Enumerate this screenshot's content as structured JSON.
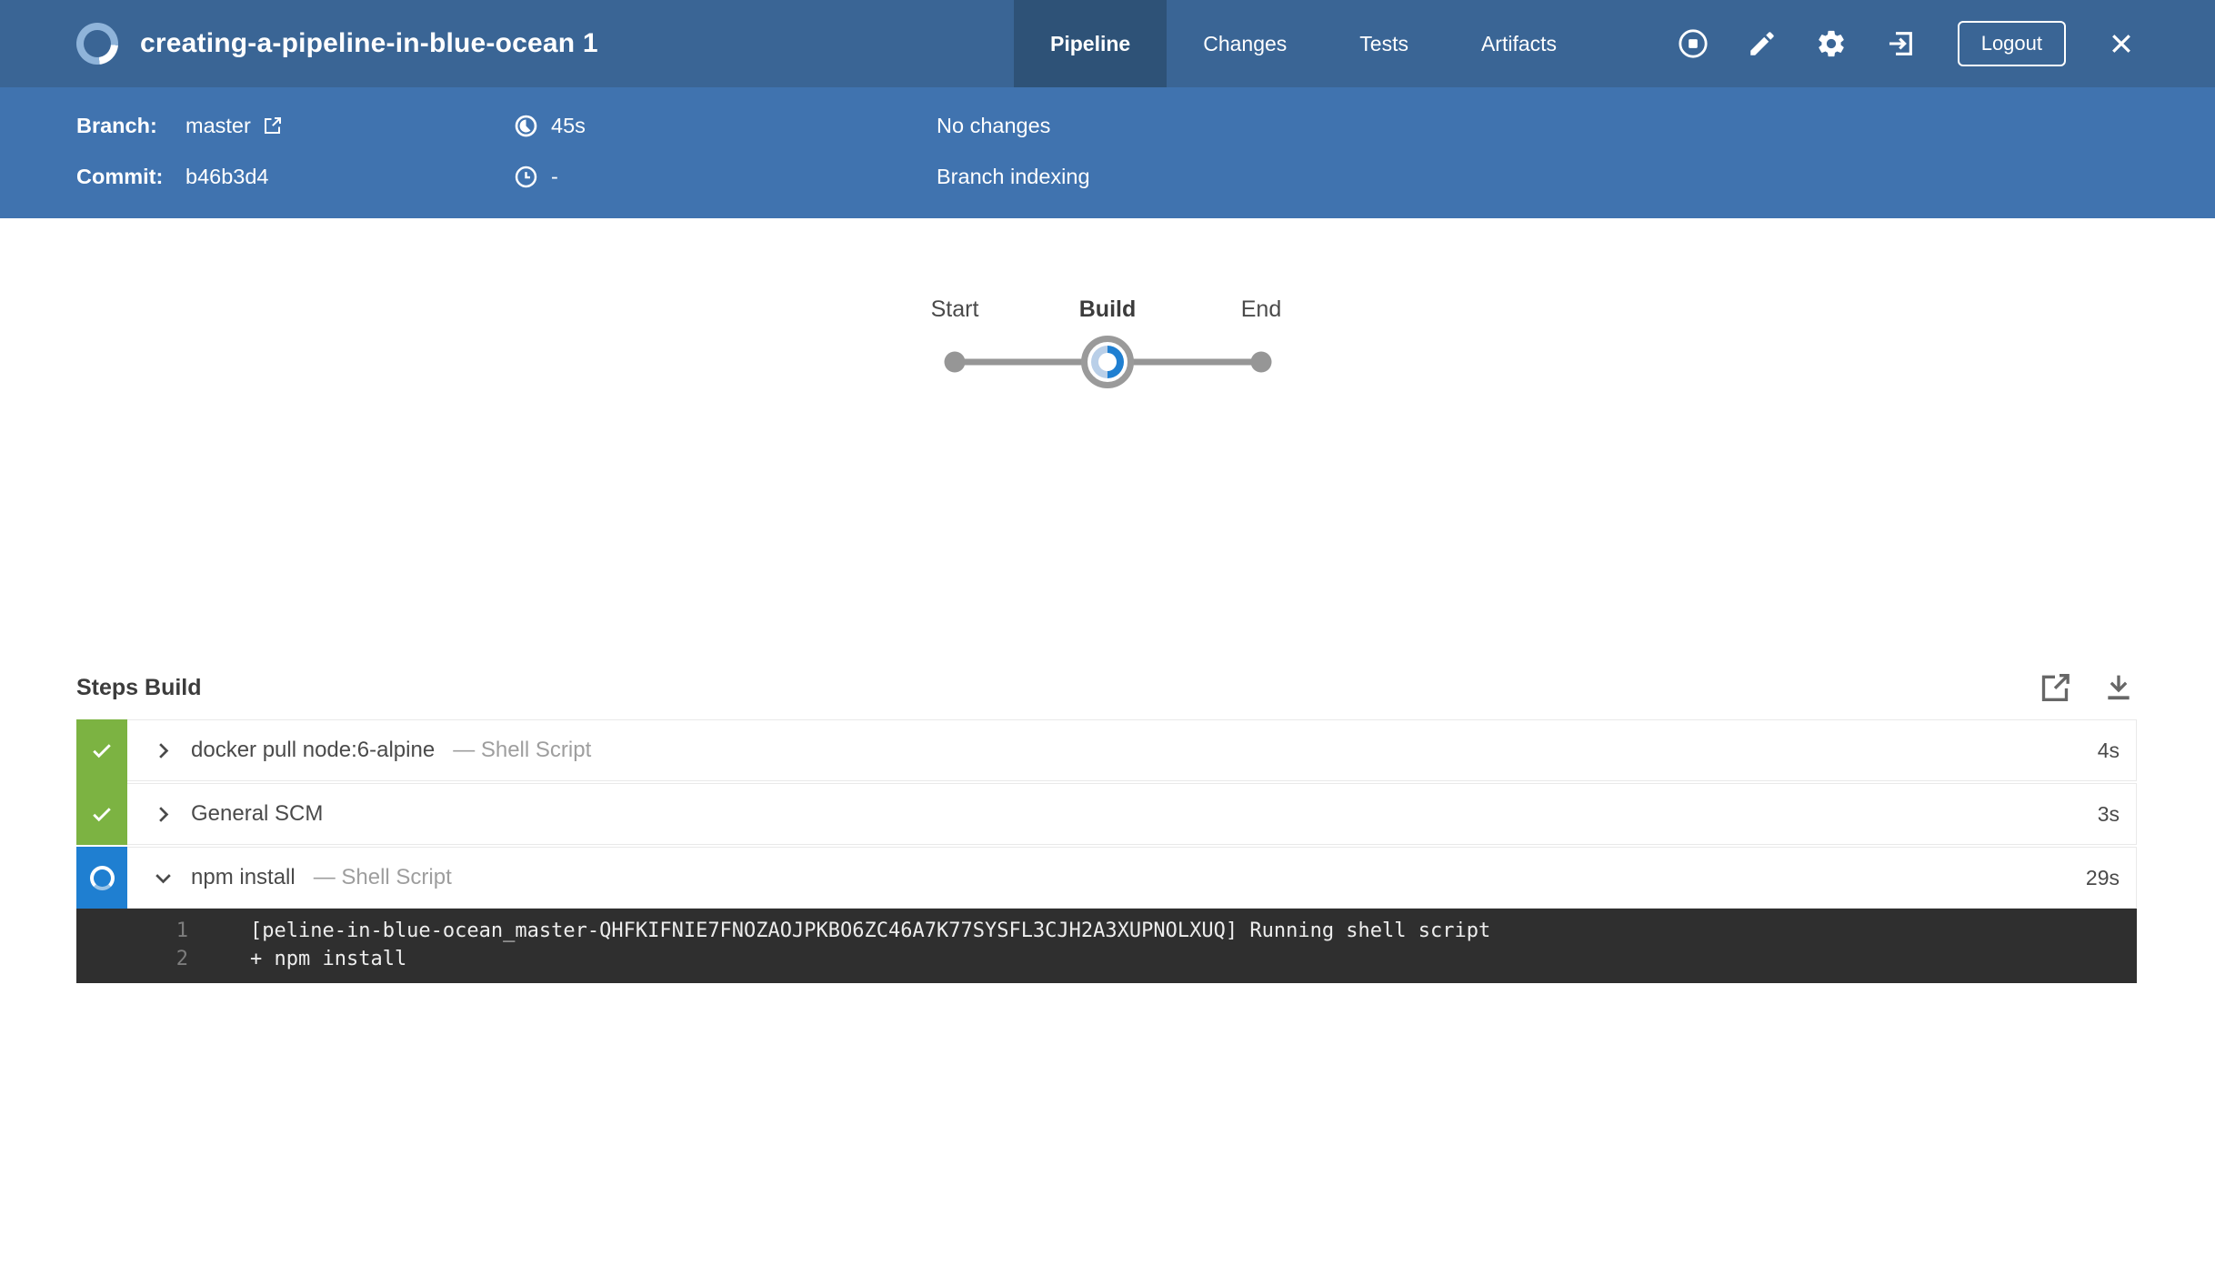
{
  "header": {
    "title": "creating-a-pipeline-in-blue-ocean 1",
    "tabs": [
      {
        "label": "Pipeline",
        "active": true
      },
      {
        "label": "Changes",
        "active": false
      },
      {
        "label": "Tests",
        "active": false
      },
      {
        "label": "Artifacts",
        "active": false
      }
    ],
    "logout_label": "Logout"
  },
  "run_info": {
    "branch_label": "Branch:",
    "branch_value": "master",
    "commit_label": "Commit:",
    "commit_value": "b46b3d4",
    "duration_value": "45s",
    "eta_value": "-",
    "changes_text": "No changes",
    "status_text": "Branch indexing"
  },
  "pipeline_graph": {
    "nodes": [
      {
        "label": "Start",
        "state": "terminal"
      },
      {
        "label": "Build",
        "state": "running"
      },
      {
        "label": "End",
        "state": "terminal"
      }
    ]
  },
  "steps": {
    "heading": "Steps Build",
    "rows": [
      {
        "name": "docker pull node:6-alpine",
        "detail": "— Shell Script",
        "duration": "4s",
        "status": "success",
        "expanded": false
      },
      {
        "name": "General SCM",
        "detail": "",
        "duration": "3s",
        "status": "success",
        "expanded": false
      },
      {
        "name": "npm install",
        "detail": "— Shell Script",
        "duration": "29s",
        "status": "running",
        "expanded": true
      }
    ],
    "console": {
      "lines": [
        {
          "num": "1",
          "text": "[peline-in-blue-ocean_master-QHFKIFNIE7FNOZAOJPKBO6ZC46A7K77SYSFL3CJH2A3XUPNOLXUQ] Running shell script"
        },
        {
          "num": "2",
          "text": "+ npm install"
        }
      ]
    }
  },
  "icons": {
    "run-status-spinner-logo": "circular progress ring",
    "stop-build-icon": "circle with square",
    "edit-pipeline-icon": "pencil",
    "settings-gear-icon": "gear",
    "go-to-classic-exit-icon": "arrow into bracket",
    "close-icon": "x",
    "branch-external-link-icon": "box with arrow",
    "duration-icon": "pie clock",
    "clock-icon": "clock",
    "open-in-new-window-icon": "box with arrow",
    "download-log-icon": "down arrow over bar",
    "check-icon": "✓",
    "chevron-right-icon": "❯",
    "chevron-down-icon": "⌄"
  },
  "colors": {
    "header_bg": "#3a6595",
    "header_active_tab_bg": "#2e5277",
    "info_bar_bg": "#4073af",
    "success_green": "#7cb342",
    "running_blue": "#1f7fd1",
    "console_bg": "#2f2f2f",
    "console_text": "#ededed",
    "console_line_num": "#7d7d7d",
    "row_border": "#e9e9e9",
    "graph_gray": "#969696",
    "text_dark": "#4a4a4a",
    "text_muted": "#9e9e9e"
  }
}
